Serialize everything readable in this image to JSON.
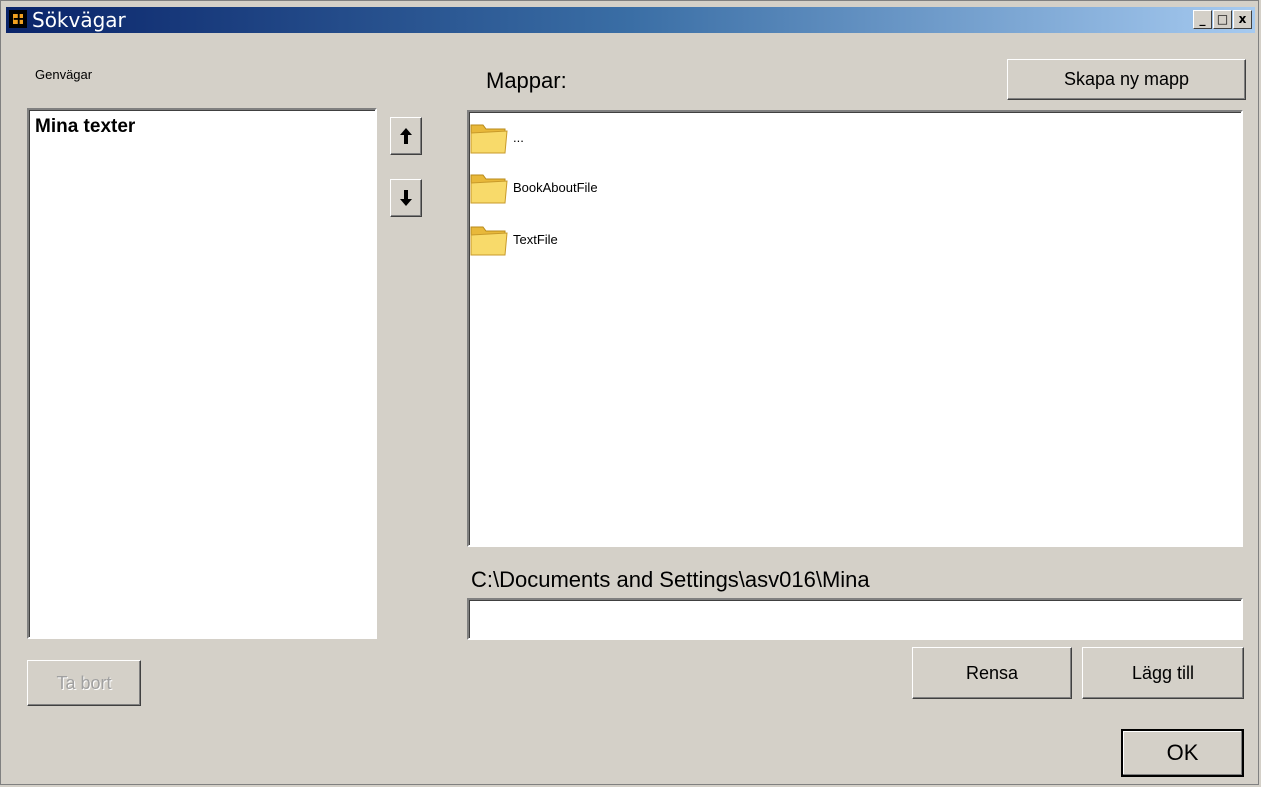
{
  "window": {
    "title": "Sökvägar",
    "controls": [
      "_",
      "□",
      "x"
    ]
  },
  "shortcuts": {
    "label": "Genvägar",
    "items": [
      "Mina texter"
    ],
    "remove_label": "Ta bort",
    "move_up_icon": "arrow-up-icon",
    "move_down_icon": "arrow-down-icon"
  },
  "folders": {
    "label": "Mappar:",
    "new_folder_label": "Skapa ny mapp",
    "items": [
      {
        "name": "...",
        "icon": "folder-icon"
      },
      {
        "name": "BookAboutFile",
        "icon": "folder-icon"
      },
      {
        "name": "TextFile",
        "icon": "folder-icon"
      }
    ]
  },
  "path": {
    "text": "C:\\Documents and Settings\\asv016\\Mina",
    "input_value": ""
  },
  "actions": {
    "clear_label": "Rensa",
    "add_label": "Lägg till",
    "ok_label": "OK"
  },
  "colors": {
    "title_start": "#0a246a",
    "title_end": "#a6caf0",
    "face": "#d4d0c8",
    "folder": "#f5d35a"
  }
}
